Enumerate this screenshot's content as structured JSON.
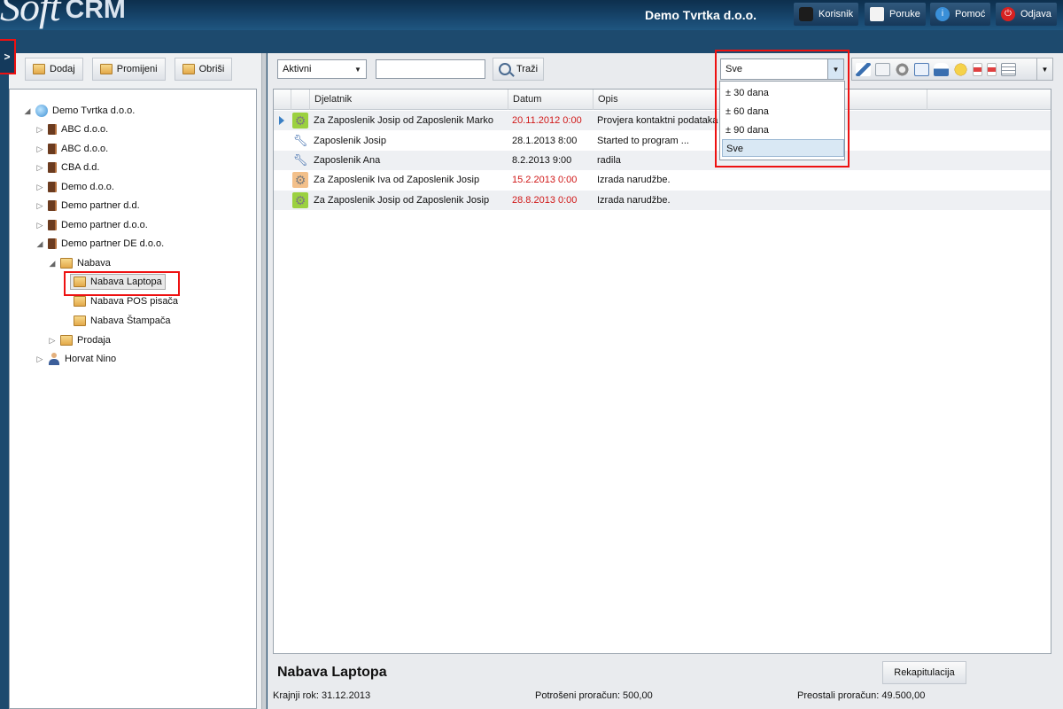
{
  "app": {
    "logo_part1": "Soft",
    "logo_part2": "CRM",
    "company": "Demo Tvrtka d.o.o."
  },
  "header": {
    "buttons": [
      {
        "label": "Korisnik",
        "icon": "user-icon"
      },
      {
        "label": "Poruke",
        "icon": "message-icon"
      },
      {
        "label": "Pomoć",
        "icon": "help-icon"
      },
      {
        "label": "Odjava",
        "icon": "power-icon"
      }
    ]
  },
  "side_toggle": ">",
  "left_toolbar": {
    "add_label": "Dodaj",
    "edit_label": "Promijeni",
    "delete_label": "Obriši"
  },
  "tree": {
    "root": "Demo Tvrtka d.o.o.",
    "nodes": [
      "ABC d.o.o.",
      "ABC d.o.o.",
      "CBA d.d.",
      "Demo d.o.o.",
      "Demo partner d.d.",
      "Demo partner d.o.o.",
      "Demo partner DE d.o.o.",
      "Nabava",
      "Nabava Laptopa",
      "Nabava POS pisača",
      "Nabava Štampača",
      "Prodaja",
      "Horvat Nino"
    ]
  },
  "filters": {
    "status": "Aktivni",
    "search_value": "",
    "search_label": "Traži",
    "period_selected": "Sve",
    "period_options": [
      "± 30 dana",
      "± 60 dana",
      "± 90 dana",
      "Sve"
    ]
  },
  "grid": {
    "columns": [
      "Djelatnik",
      "Datum",
      "Opis"
    ],
    "rows": [
      {
        "type": "gear",
        "worker": "Za Zaposlenik Josip od Zaposlenik Marko",
        "date": "20.11.2012 0:00",
        "desc": "Provjera kontaktni podataka",
        "overdue": true,
        "highlight": "#9bd13f"
      },
      {
        "type": "wrench",
        "worker": "Zaposlenik Josip",
        "date": "28.1.2013 8:00",
        "desc": "Started to program ...",
        "overdue": false
      },
      {
        "type": "wrench",
        "worker": "Zaposlenik Ana",
        "date": "8.2.2013 9:00",
        "desc": "radila",
        "overdue": false
      },
      {
        "type": "gear",
        "worker": "Za Zaposlenik Iva od Zaposlenik Josip",
        "date": "15.2.2013 0:00",
        "desc": "Izrada narudžbe.",
        "overdue": true,
        "highlight": "#f3c08a"
      },
      {
        "type": "gear",
        "worker": "Za Zaposlenik Josip od Zaposlenik Josip",
        "date": "28.8.2013 0:00",
        "desc": "Izrada narudžbe.",
        "overdue": true,
        "highlight": "#9bd13f"
      }
    ]
  },
  "footer": {
    "title": "Nabava Laptopa",
    "recap_label": "Rekapitulacija",
    "deadline": "Krajnji rok: 31.12.2013",
    "spent": "Potrošeni proračun: 500,00",
    "remaining": "Preostali proračun: 49.500,00"
  }
}
